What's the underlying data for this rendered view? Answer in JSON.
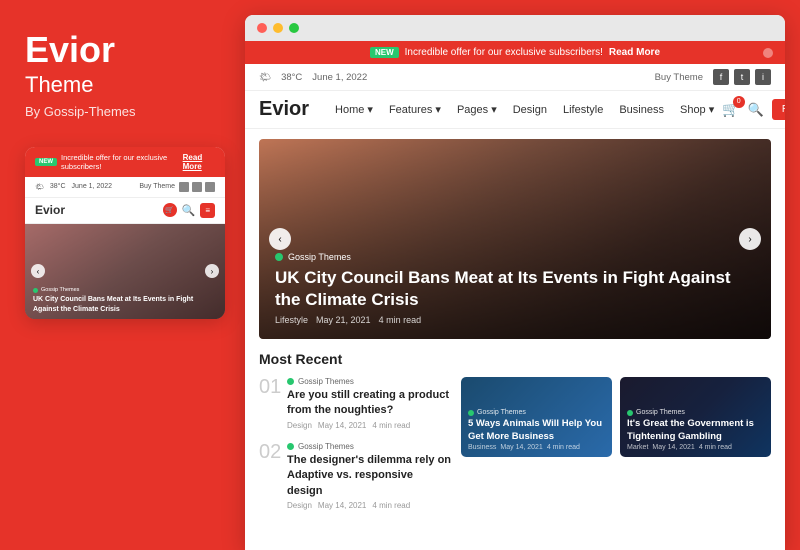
{
  "left": {
    "brand_title": "Evior",
    "brand_subtitle": "Theme",
    "brand_by": "By Gossip-Themes",
    "mini": {
      "notif_badge": "NEW",
      "notif_text": "Incredible offer for our exclusive subscribers!",
      "notif_link": "Read More",
      "weather": "38°C",
      "date": "June 1, 2022",
      "buy_theme": "Buy Theme",
      "logo": "Evior",
      "hero_tag": "Gossip Themes",
      "hero_title": "UK City Council Bans Meat at Its Events in Fight Against the Climate Crisis",
      "arrow_left": "‹",
      "arrow_right": "›"
    }
  },
  "browser": {
    "dots": [
      "red",
      "yellow",
      "green"
    ],
    "notif_bar": {
      "badge": "NEW",
      "text": "Incredible offer for our exclusive subscribers!",
      "link": "Read More"
    },
    "top_bar": {
      "weather": "38°C",
      "date": "June 1, 2022",
      "buy_theme": "Buy Theme"
    },
    "nav": {
      "logo": "Evior",
      "items": [
        "Home",
        "Features",
        "Pages",
        "Design",
        "Lifestyle",
        "Business",
        "Shop"
      ],
      "cart_count": "0",
      "register_btn": "Register Now"
    },
    "hero": {
      "tag": "Gossip Themes",
      "title": "UK City Council Bans Meat at Its Events in Fight Against the Climate Crisis",
      "category": "Lifestyle",
      "date": "May 21, 2021",
      "read_time": "4 min read",
      "arrow_left": "‹",
      "arrow_right": "›"
    },
    "most_recent": {
      "section_title": "Most Recent",
      "articles": [
        {
          "number": "01",
          "tag": "Gossip Themes",
          "title": "Are you still creating a product from the noughties?",
          "category": "Design",
          "date": "May 14, 2021",
          "read_time": "4 min read"
        },
        {
          "number": "02",
          "tag": "Gossip Themes",
          "title": "The designer's dilemma rely on Adaptive vs. responsive design",
          "category": "Design",
          "date": "May 14, 2021",
          "read_time": "4 min read"
        }
      ]
    },
    "cards": [
      {
        "tag": "Gossip Themes",
        "title": "5 Ways Animals Will Help You Get More Business",
        "category": "Business",
        "date": "May 14, 2021",
        "read_time": "4 min read",
        "bg": "blue"
      },
      {
        "tag": "Gossip Themes",
        "title": "It's Great the Government is Tightening Gambling",
        "category": "Market",
        "date": "May 14, 2021",
        "read_time": "4 min read",
        "bg": "dark"
      }
    ]
  },
  "icons": {
    "arrow_left": "‹",
    "arrow_right": "›",
    "cart": "🛒",
    "search": "🔍",
    "facebook": "f",
    "twitter": "t",
    "instagram": "i",
    "weather": "🌤"
  }
}
